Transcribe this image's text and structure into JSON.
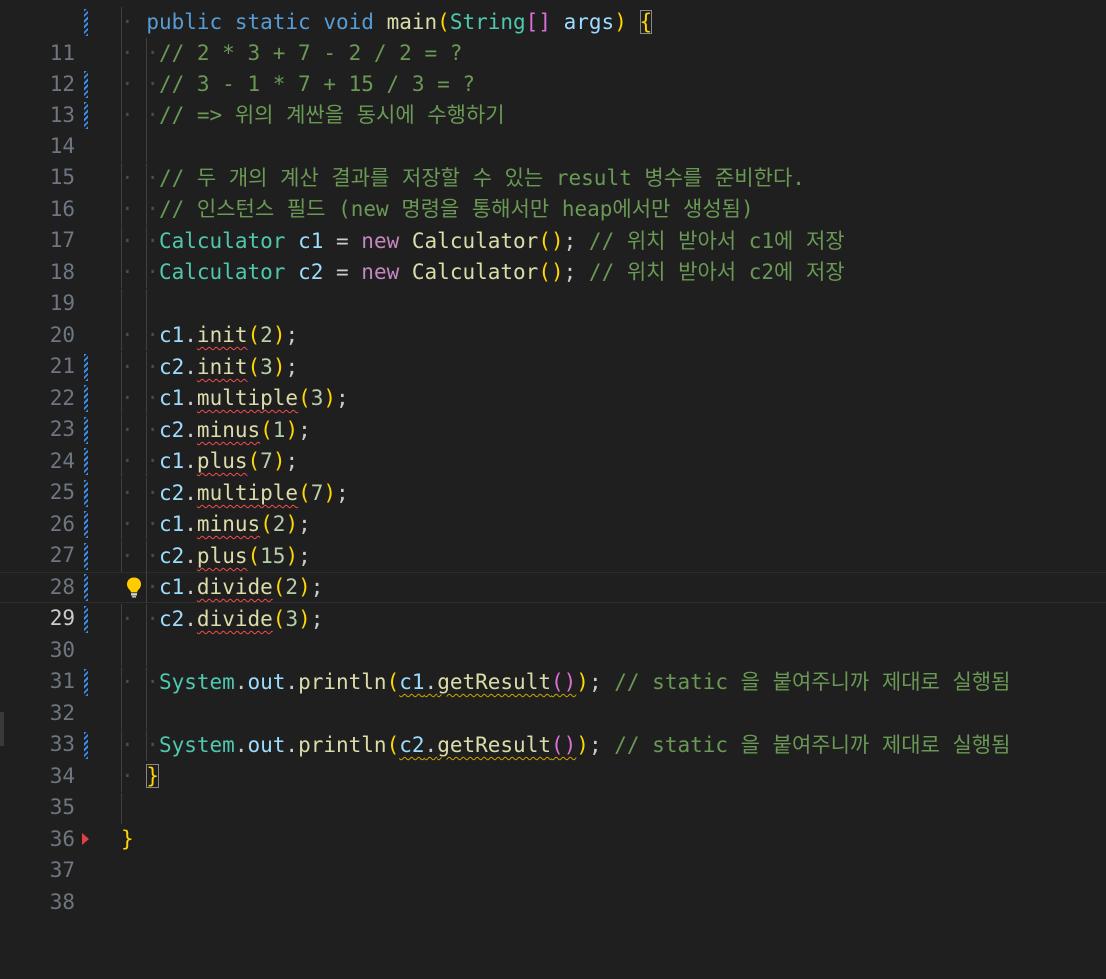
{
  "editor": {
    "tokens": {
      "public": "public",
      "static": "static",
      "void": "void",
      "main": "main",
      "String": "String",
      "args": "args",
      "Calculator": "Calculator",
      "new": "new",
      "c1": "c1",
      "c2": "c2",
      "init": "init",
      "multiple": "multiple",
      "minus": "minus",
      "plus": "plus",
      "divide": "divide",
      "System": "System",
      "out": "out",
      "println": "println",
      "getResult": "getResult"
    },
    "numbers": [
      "2",
      "3",
      "3",
      "1",
      "7",
      "7",
      "2",
      "15",
      "2",
      "3"
    ],
    "comments": {
      "c12": "// 2 * 3 + 7 - 2 / 2 = ?",
      "c13": "// 3 - 1 * 7 + 15 / 3 = ?",
      "c14": "// => 위의 계싼을 동시에 수행하기",
      "c16": "// 두 개의 계산 결과를 저장할 수 있는 result 병수를 준비한다.",
      "c17": "// 인스턴스 필드 (new 명령을 통해서만 heap에서만 생성됨)",
      "c18": "// 위치 받아서 c1에 저장",
      "c19": "// 위치 받아서 c2에 저장",
      "c32": "// static 을 붙여주니까 제대로 실행됨",
      "c34": "// static 을 붙여주니까 제대로 실행됨"
    },
    "line_numbers": [
      "11",
      "12",
      "13",
      "14",
      "15",
      "16",
      "17",
      "18",
      "19",
      "20",
      "21",
      "22",
      "23",
      "24",
      "25",
      "26",
      "27",
      "28",
      "29",
      "30",
      "31",
      "32",
      "33",
      "34",
      "35",
      "36",
      "37",
      "38"
    ],
    "current_line": "29",
    "lightbulb_icon": "lightbulb-icon"
  }
}
